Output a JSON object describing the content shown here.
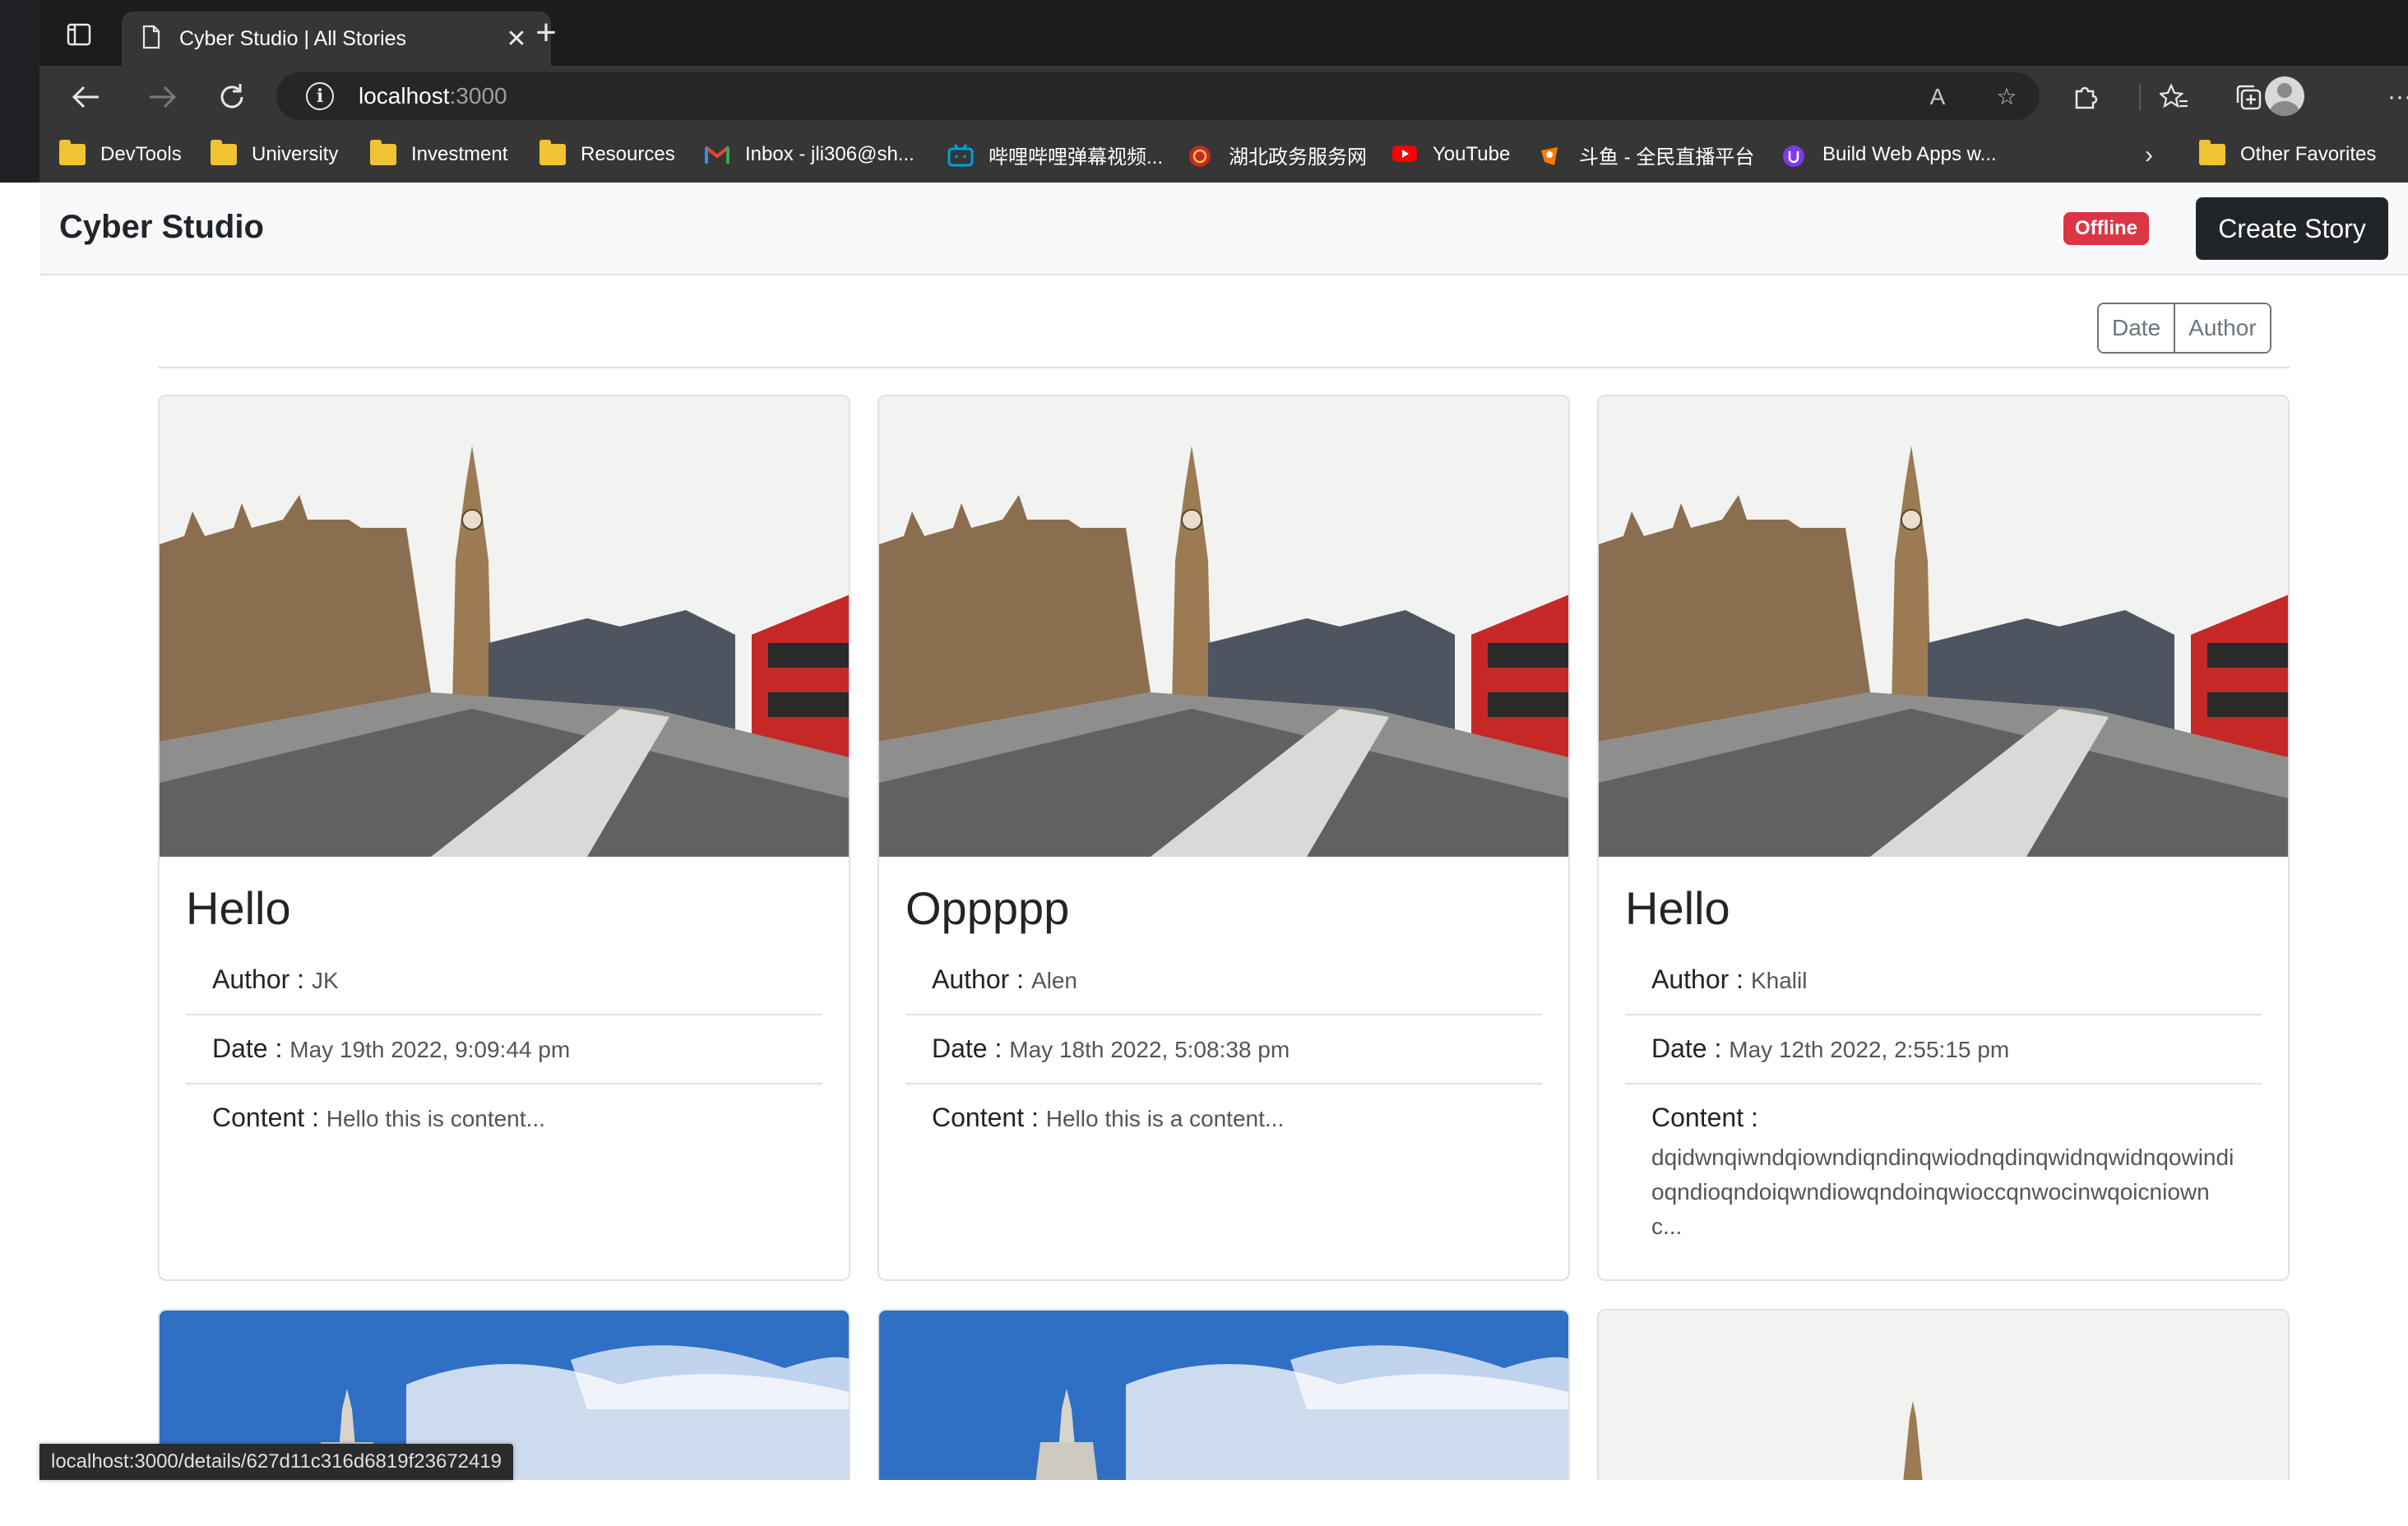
{
  "browser": {
    "tab_title": "Cyber Studio | All Stories",
    "url_host": "localhost",
    "url_port": ":3000",
    "bookmarks": [
      {
        "label": "DevTools",
        "icon": "folder-icon"
      },
      {
        "label": "University",
        "icon": "folder-icon"
      },
      {
        "label": "Investment",
        "icon": "folder-icon"
      },
      {
        "label": "Resources",
        "icon": "folder-icon"
      },
      {
        "label": "Inbox - jli306@sh...",
        "icon": "gmail-icon"
      },
      {
        "label": "哔哩哔哩弹幕视频...",
        "icon": "bilibili-icon"
      },
      {
        "label": "湖北政务服务网",
        "icon": "gov-icon"
      },
      {
        "label": "YouTube",
        "icon": "youtube-icon"
      },
      {
        "label": "斗鱼 - 全民直播平台",
        "icon": "douyu-icon"
      },
      {
        "label": "Build Web Apps w...",
        "icon": "vite-icon"
      }
    ],
    "other_favorites": "Other Favorites",
    "status_url": "localhost:3000/details/627d11c316d6819f23672419"
  },
  "app": {
    "brand": "Cyber Studio",
    "status_badge": "Offline",
    "create_button": "Create Story",
    "sort": {
      "date": "Date",
      "author": "Author"
    },
    "labels": {
      "author": "Author :",
      "date": "Date :",
      "content": "Content :"
    },
    "stories": [
      {
        "title": "Hello",
        "author": "JK",
        "date": "May 19th 2022, 9:09:44 pm",
        "content": "Hello this is content...",
        "image": "big-ben-photo"
      },
      {
        "title": "Oppppp",
        "author": "Alen",
        "date": "May 18th 2022, 5:08:38 pm",
        "content": "Hello this is a content...",
        "image": "big-ben-photo"
      },
      {
        "title": "Hello",
        "author": "Khalil",
        "date": "May 12th 2022, 2:55:15 pm",
        "content": "dqidwnqiwndqiowndiqndinqwiodnqdinqwidnqwidnqowindioqndioqndoiqwndiowqndoinqwioccqnwocinwqoicniownc...",
        "image": "big-ben-photo"
      }
    ],
    "partial_cards": [
      {
        "image": "tower-bridge-photo"
      },
      {
        "image": "tower-bridge-photo"
      },
      {
        "image": "big-ben-photo"
      }
    ]
  },
  "colors": {
    "offline": "#dc3545",
    "dark_button": "#212529",
    "chrome_bg": "#363636"
  }
}
